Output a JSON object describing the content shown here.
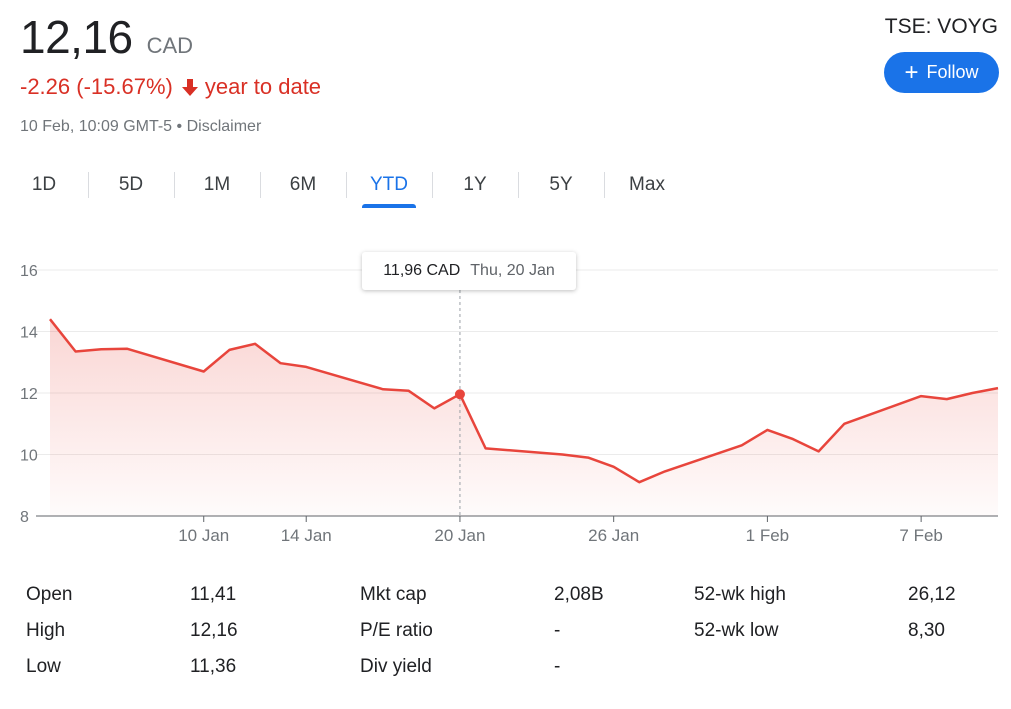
{
  "quote": {
    "price": "12,16",
    "currency": "CAD",
    "change": "-2.26 (-15.67%)",
    "change_period": "year to date",
    "timestamp": "10 Feb, 10:09 GMT-5",
    "disclaimer": "Disclaimer",
    "separator": "•",
    "ticker": "TSE: VOYG",
    "follow_label": "Follow",
    "down_color": "#d93025",
    "accent_color": "#1a73e8"
  },
  "tabs": [
    {
      "label": "1D",
      "active": false
    },
    {
      "label": "5D",
      "active": false
    },
    {
      "label": "1M",
      "active": false
    },
    {
      "label": "6M",
      "active": false
    },
    {
      "label": "YTD",
      "active": true
    },
    {
      "label": "1Y",
      "active": false
    },
    {
      "label": "5Y",
      "active": false
    },
    {
      "label": "Max",
      "active": false
    }
  ],
  "tooltip": {
    "price": "11,96 CAD",
    "date": "Thu, 20 Jan"
  },
  "chart_data": {
    "type": "line",
    "title": "",
    "xlabel": "",
    "ylabel": "",
    "ylim": [
      8,
      16
    ],
    "y_ticks": [
      "16",
      "14",
      "12",
      "10",
      "8"
    ],
    "y_tick_values": [
      16,
      14,
      12,
      10,
      8
    ],
    "x_ticks": [
      "10 Jan",
      "14 Jan",
      "20 Jan",
      "26 Jan",
      "1 Feb",
      "7 Feb"
    ],
    "x_tick_dates": [
      "2022-01-10",
      "2022-01-14",
      "2022-01-20",
      "2022-01-26",
      "2022-02-01",
      "2022-02-07"
    ],
    "x_range": [
      "2022-01-04",
      "2022-02-10"
    ],
    "grid": true,
    "line_color": "#e8453c",
    "highlight_date": "2022-01-20",
    "series": [
      {
        "x": [
          "2022-01-04",
          "2022-01-05",
          "2022-01-06",
          "2022-01-07",
          "2022-01-10",
          "2022-01-11",
          "2022-01-12",
          "2022-01-13",
          "2022-01-14",
          "2022-01-17",
          "2022-01-18",
          "2022-01-19",
          "2022-01-20",
          "2022-01-21",
          "2022-01-24",
          "2022-01-25",
          "2022-01-26",
          "2022-01-27",
          "2022-01-28",
          "2022-01-31",
          "2022-02-01",
          "2022-02-02",
          "2022-02-03",
          "2022-02-04",
          "2022-02-07",
          "2022-02-08",
          "2022-02-09",
          "2022-02-10"
        ],
        "values": [
          14.4,
          13.35,
          13.42,
          13.44,
          12.7,
          13.4,
          13.6,
          12.97,
          12.85,
          12.12,
          12.07,
          11.5,
          11.96,
          10.2,
          10.0,
          9.9,
          9.6,
          9.1,
          9.45,
          10.3,
          10.8,
          10.5,
          10.1,
          11.0,
          11.9,
          11.8,
          12.0,
          12.16
        ]
      }
    ]
  },
  "stats": [
    {
      "label": "Open",
      "value": "11,41"
    },
    {
      "label": "High",
      "value": "12,16"
    },
    {
      "label": "Low",
      "value": "11,36"
    },
    {
      "label": "Mkt cap",
      "value": "2,08B"
    },
    {
      "label": "P/E ratio",
      "value": "-"
    },
    {
      "label": "Div yield",
      "value": "-"
    },
    {
      "label": "52-wk high",
      "value": "26,12"
    },
    {
      "label": "52-wk low",
      "value": "8,30"
    }
  ]
}
